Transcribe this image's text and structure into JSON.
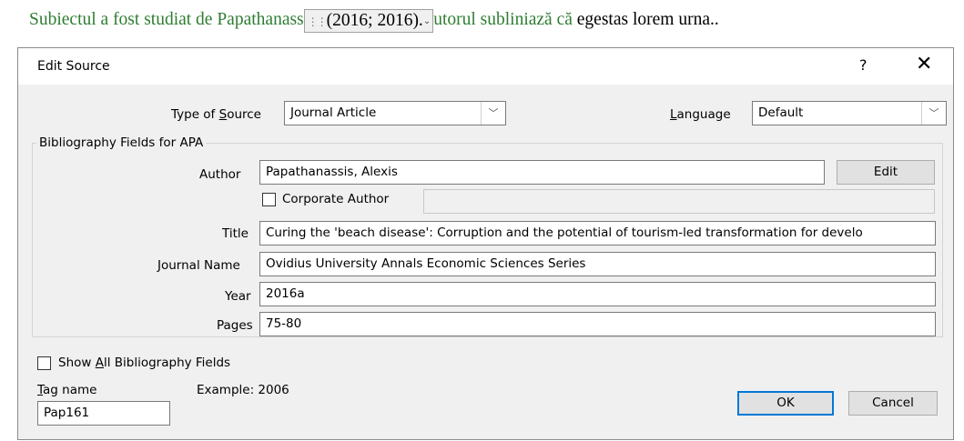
{
  "document": {
    "text_before": "Subiectul a fost studiat de Papathanass",
    "citation_hidden": "is",
    "citation": "(2016; 2016).",
    "text_after_green": "utorul subliniază că",
    "text_after_black": " egestas lorem urna.."
  },
  "dialog": {
    "title": "Edit Source",
    "help": "?",
    "close": "✕",
    "type_of_source": {
      "label_pre": "Type of ",
      "label_u": "S",
      "label_post": "ource",
      "value": "Journal Article"
    },
    "language": {
      "label_u": "L",
      "label_post": "anguage",
      "value": "Default"
    },
    "group_title": "Bibliography Fields for APA",
    "author": {
      "label": "Author",
      "value": "Papathanassis, Alexis",
      "edit_button": "Edit"
    },
    "corporate_author": {
      "label": "Corporate Author",
      "value": ""
    },
    "title_field": {
      "label": "Title",
      "value": "Curing the 'beach disease': Corruption and the potential of tourism-led transformation for develo"
    },
    "journal_name": {
      "label": "Journal Name",
      "value": "Ovidius University Annals Economic Sciences Series"
    },
    "year": {
      "label": "Year",
      "value": "2016a"
    },
    "pages": {
      "label": "Pages",
      "value": "75-80"
    },
    "show_all": {
      "label_pre": "Show ",
      "label_u": "A",
      "label_post": "ll Bibliography Fields"
    },
    "tag_name": {
      "label_u": "T",
      "label_post": "ag name",
      "value": "Pap161"
    },
    "example": "Example: 2006",
    "ok": "OK",
    "cancel": "Cancel"
  }
}
